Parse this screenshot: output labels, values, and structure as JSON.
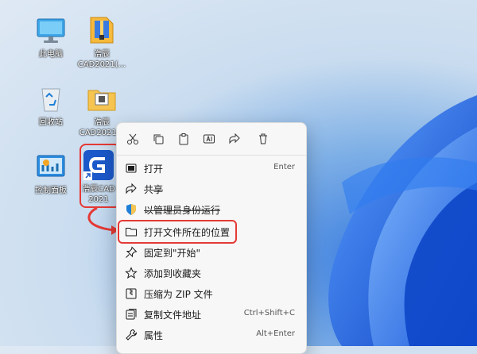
{
  "desktop": {
    "icons": [
      {
        "label": "此电脑"
      },
      {
        "label": "浩辰\nCAD2021(..."
      },
      {
        "label": "回收站"
      },
      {
        "label": "浩辰\nCAD2021..."
      },
      {
        "label": "控制面板"
      },
      {
        "label": "浩辰CAD\n2021"
      }
    ]
  },
  "context_menu": {
    "toolbar": [
      {
        "icon": "cut-icon"
      },
      {
        "icon": "copy-icon"
      },
      {
        "icon": "paste-icon"
      },
      {
        "icon": "rename-icon"
      },
      {
        "icon": "share-icon"
      },
      {
        "icon": "delete-icon"
      }
    ],
    "items": [
      {
        "label": "打开",
        "shortcut": "Enter",
        "icon": "open-icon"
      },
      {
        "label": "共享",
        "shortcut": "",
        "icon": "share-icon"
      },
      {
        "label": "以管理员身份运行",
        "shortcut": "",
        "icon": "shield-icon"
      },
      {
        "label": "打开文件所在的位置",
        "shortcut": "",
        "icon": "folder-icon"
      },
      {
        "label": "固定到\"开始\"",
        "shortcut": "",
        "icon": "pin-icon"
      },
      {
        "label": "添加到收藏夹",
        "shortcut": "",
        "icon": "star-icon"
      },
      {
        "label": "压缩为 ZIP 文件",
        "shortcut": "",
        "icon": "zip-icon"
      },
      {
        "label": "复制文件地址",
        "shortcut": "Ctrl+Shift+C",
        "icon": "copy-path-icon"
      },
      {
        "label": "属性",
        "shortcut": "Alt+Enter",
        "icon": "wrench-icon"
      }
    ]
  },
  "colors": {
    "accent": "#0a64d6",
    "highlight_border": "#e53935"
  }
}
